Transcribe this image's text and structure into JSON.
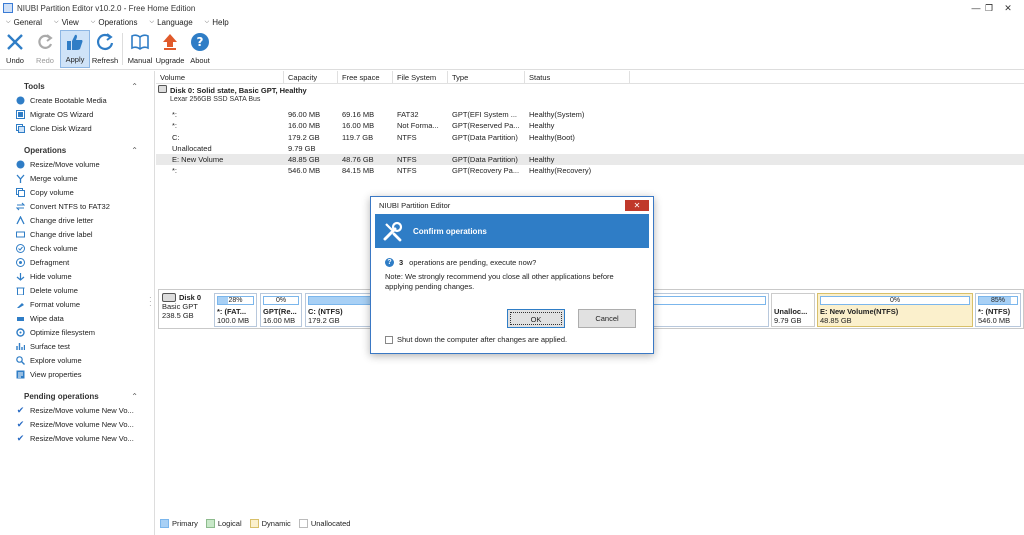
{
  "window": {
    "title": "NIUBI Partition Editor v10.2.0 - Free Home Edition",
    "minimize": "—",
    "maximize": "❐",
    "close": "✕"
  },
  "menu": [
    {
      "label": "General"
    },
    {
      "label": "View"
    },
    {
      "label": "Operations"
    },
    {
      "label": "Language"
    },
    {
      "label": "Help"
    }
  ],
  "toolbar": {
    "undo": "Undo",
    "redo": "Redo",
    "apply": "Apply",
    "refresh": "Refresh",
    "manual": "Manual",
    "upgrade": "Upgrade",
    "about": "About"
  },
  "sidebar": {
    "tools": {
      "title": "Tools",
      "items": [
        "Create Bootable Media",
        "Migrate OS Wizard",
        "Clone Disk Wizard"
      ]
    },
    "operations": {
      "title": "Operations",
      "items": [
        "Resize/Move volume",
        "Merge volume",
        "Copy volume",
        "Convert NTFS to FAT32",
        "Change drive letter",
        "Change drive label",
        "Check volume",
        "Defragment",
        "Hide volume",
        "Delete volume",
        "Format volume",
        "Wipe data",
        "Optimize filesystem",
        "Surface test",
        "Explore volume",
        "View properties"
      ]
    },
    "pending": {
      "title": "Pending operations",
      "items": [
        "Resize/Move volume New Vo...",
        "Resize/Move volume New Vo...",
        "Resize/Move volume New Vo..."
      ]
    }
  },
  "table": {
    "columns": [
      "Volume",
      "Capacity",
      "Free space",
      "File System",
      "Type",
      "Status"
    ],
    "disk": {
      "title": "Disk 0: Solid state, Basic GPT, Healthy",
      "subtitle": "Lexar 256GB SSD SATA Bus"
    },
    "rows": [
      {
        "volume": "*:",
        "capacity": "96.00 MB",
        "free": "69.16 MB",
        "fs": "FAT32",
        "type": "GPT(EFI System ...",
        "status": "Healthy(System)"
      },
      {
        "volume": "*:",
        "capacity": "16.00 MB",
        "free": "16.00 MB",
        "fs": "Not Forma...",
        "type": "GPT(Reserved Pa...",
        "status": "Healthy"
      },
      {
        "volume": "C:",
        "capacity": "179.2 GB",
        "free": "119.7 GB",
        "fs": "NTFS",
        "type": "GPT(Data Partition)",
        "status": "Healthy(Boot)"
      },
      {
        "volume": "Unallocated",
        "capacity": "9.79 GB",
        "free": "",
        "fs": "",
        "type": "",
        "status": ""
      },
      {
        "volume": "E: New Volume",
        "capacity": "48.85 GB",
        "free": "48.76 GB",
        "fs": "NTFS",
        "type": "GPT(Data Partition)",
        "status": "Healthy"
      },
      {
        "volume": "*:",
        "capacity": "546.0 MB",
        "free": "84.15 MB",
        "fs": "NTFS",
        "type": "GPT(Recovery Pa...",
        "status": "Healthy(Recovery)"
      }
    ]
  },
  "diskmap": {
    "disk_title": "Disk 0",
    "disk_type": "Basic GPT",
    "disk_size": "238.5 GB",
    "partitions": [
      {
        "pct": "28%",
        "fill": 0.28,
        "name": "*: (FAT...",
        "size": "100.0 MB"
      },
      {
        "pct": "0%",
        "fill": 0.0,
        "name": "GPT(Re...",
        "size": "16.00 MB"
      },
      {
        "pct": "",
        "fill": 0.33,
        "name": "C: (NTFS)",
        "size": "179.2 GB"
      },
      {
        "pct": "",
        "fill": 0.0,
        "name": "Unalloc...",
        "size": "9.79 GB"
      },
      {
        "pct": "0%",
        "fill": 0.0,
        "name": "E: New Volume(NTFS)",
        "size": "48.85 GB"
      },
      {
        "pct": "85%",
        "fill": 0.85,
        "name": "*: (NTFS)",
        "size": "546.0 MB"
      }
    ]
  },
  "legend": [
    "Primary",
    "Logical",
    "Dynamic",
    "Unallocated"
  ],
  "dialog": {
    "window_title": "NIUBI Partition Editor",
    "close": "✕",
    "banner": "Confirm operations",
    "count": "3",
    "question": "operations are pending, execute now?",
    "note": "Note: We strongly recommend you close all other applications before applying pending changes.",
    "ok": "OK",
    "cancel": "Cancel",
    "shutdown": "Shut down the computer after changes are applied."
  },
  "colors": {
    "accent": "#2f7dc6",
    "primary_fill": "#a8d0f5",
    "dynamic": "#fbf0cc",
    "close_red": "#c0392b"
  }
}
